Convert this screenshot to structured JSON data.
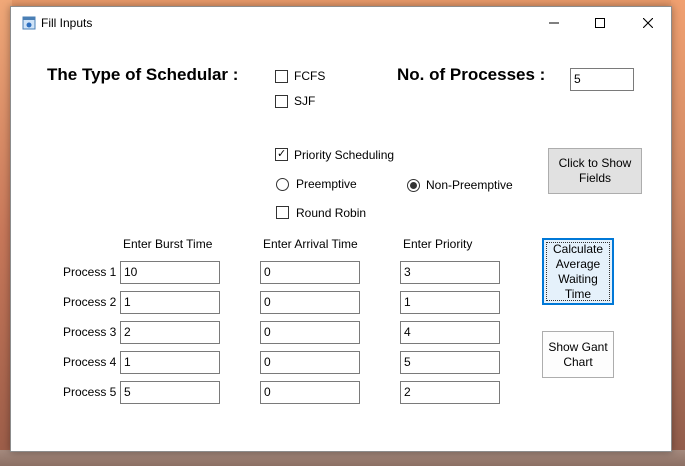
{
  "window": {
    "title": "Fill Inputs"
  },
  "scheduler": {
    "heading": "The Type of Schedular :",
    "options": [
      {
        "label": "FCFS",
        "checked": false
      },
      {
        "label": "SJF",
        "checked": false
      },
      {
        "label": "Priority Scheduling",
        "checked": true
      },
      {
        "label": "Round Robin",
        "checked": false
      }
    ],
    "mode": [
      {
        "label": "Preemptive",
        "selected": false
      },
      {
        "label": "Non-Preemptive",
        "selected": true
      }
    ]
  },
  "processes_count": {
    "heading": "No. of Processes :",
    "value": "5"
  },
  "buttons": {
    "show_fields": "Click to Show Fields",
    "calculate": "Calculate Average Waiting Time",
    "gantt": "Show Gant Chart"
  },
  "table": {
    "headers": [
      "Enter Burst Time",
      "Enter Arrival Time",
      "Enter Priority"
    ],
    "rows": [
      {
        "label": "Process 1",
        "burst": "10",
        "arrival": "0",
        "priority": "3"
      },
      {
        "label": "Process 2",
        "burst": "1",
        "arrival": "0",
        "priority": "1"
      },
      {
        "label": "Process 3",
        "burst": "2",
        "arrival": "0",
        "priority": "4"
      },
      {
        "label": "Process 4",
        "burst": "1",
        "arrival": "0",
        "priority": "5"
      },
      {
        "label": "Process 5",
        "burst": "5",
        "arrival": "0",
        "priority": "2"
      }
    ]
  },
  "icons": {
    "app": "form-icon",
    "minimize": "minimize-icon",
    "maximize": "maximize-icon",
    "close": "close-icon"
  },
  "colors": {
    "focus_border": "#0078d7",
    "button_bg": "#e1e1e1"
  }
}
